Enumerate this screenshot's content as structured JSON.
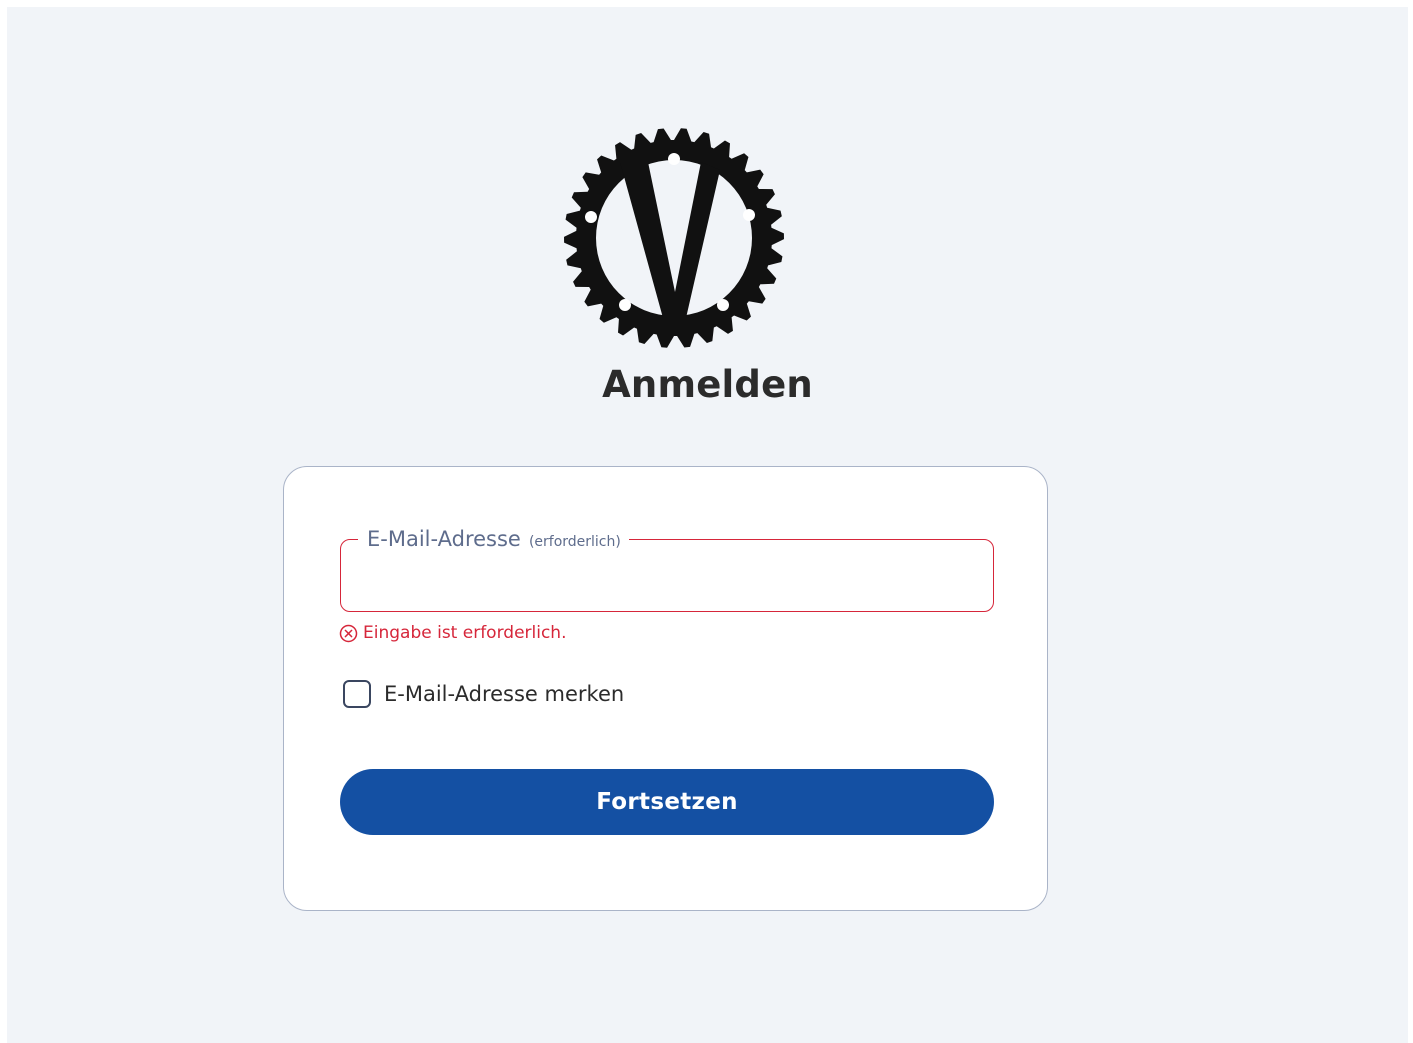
{
  "page": {
    "title": "Anmelden",
    "background_color": "#f1f4f8"
  },
  "logo": {
    "icon": "gear-v-logo-icon",
    "color": "#111111"
  },
  "form": {
    "email": {
      "label": "E-Mail-Adresse",
      "required_hint": "(erforderlich)",
      "value": "",
      "placeholder": "",
      "error_text": "Eingabe ist erforderlich.",
      "error_icon": "error-circle-x-icon",
      "error_color": "#d6263a"
    },
    "remember": {
      "label": "E-Mail-Adresse merken",
      "checked": false
    },
    "submit": {
      "label": "Fortsetzen",
      "color": "#1450a3"
    }
  }
}
